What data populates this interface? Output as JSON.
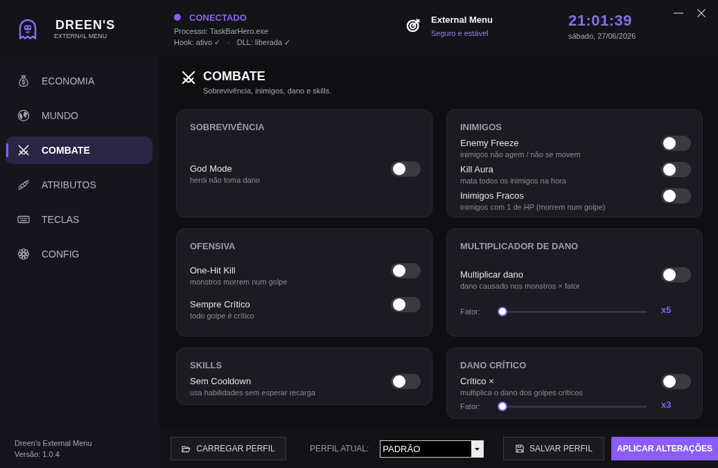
{
  "brand": {
    "title": "DREEN'S",
    "subtitle": "EXTERNAL MENU"
  },
  "status": {
    "connected": true,
    "label": "CONECTADO",
    "process": "Processo: TaskBarHero.exe",
    "details": [
      "Hook: ativo ✓",
      "·",
      "DLL: liberada ✓"
    ]
  },
  "service": {
    "title": "External Menu",
    "subtitle": "Seguro e estável"
  },
  "clock": {
    "time": "21:01:39",
    "date": "sábado, 27/06/2026"
  },
  "sidebar": {
    "items": [
      {
        "label": "ECONOMIA",
        "selected": false
      },
      {
        "label": "MUNDO",
        "selected": false
      },
      {
        "label": "COMBATE",
        "selected": true
      },
      {
        "label": "ATRIBUTOS",
        "selected": false
      },
      {
        "label": "TECLAS",
        "selected": false
      },
      {
        "label": "CONFIG",
        "selected": false
      }
    ],
    "footer": [
      "Dreen's External Menu",
      "Versão: 1.0.4"
    ]
  },
  "page": {
    "title": "COMBATE",
    "subtitle": "Sobrevivência, inimigos, dano e skills."
  },
  "cards": [
    {
      "title": "SOBREVIVÊNCIA",
      "items": [
        {
          "kind": "toggle",
          "label": "God Mode",
          "description": "herói não toma dano",
          "on": false
        }
      ]
    },
    {
      "title": "INIMIGOS",
      "items": [
        {
          "kind": "toggle",
          "label": "Enemy Freeze",
          "description": "inimigos não agem / não se movem",
          "on": false
        },
        {
          "kind": "toggle",
          "label": "Kill Aura",
          "description": "mata todos os inimigos na hora",
          "on": false
        },
        {
          "kind": "toggle",
          "label": "Inimigos Fracos",
          "description": "inimigos com 1 de HP (morrem num golpe)",
          "on": false
        }
      ]
    },
    {
      "title": "OFENSIVA",
      "items": [
        {
          "kind": "toggle",
          "label": "One-Hit Kill",
          "description": "monstros morrem num golpe",
          "on": false
        },
        {
          "kind": "toggle",
          "label": "Sempre Crítico",
          "description": "todo golpe é crítico",
          "on": false
        }
      ]
    },
    {
      "title": "MULTIPLICADOR DE DANO",
      "items": [
        {
          "kind": "toggle",
          "label": "Multiplicar dano",
          "description": "dano causado nos monstros × fator",
          "on": false
        },
        {
          "kind": "slider",
          "label": "Fator:",
          "level": 0,
          "reading": "x5"
        }
      ]
    },
    {
      "title": "SKILLS",
      "items": [
        {
          "kind": "toggle",
          "label": "Sem Cooldown",
          "description": "usa habilidades sem esperar recarga",
          "on": false
        }
      ]
    },
    {
      "title": "DANO CRÍTICO",
      "items": [
        {
          "kind": "toggle",
          "label": "Crítico ×",
          "description": "multiplica o dano dos golpes críticos",
          "on": false
        },
        {
          "kind": "slider",
          "label": "Fator:",
          "level": 0,
          "reading": "x3"
        }
      ]
    }
  ],
  "bottom_bar": {
    "load_button": "CARREGAR PERFIL",
    "profile_label": "PERFIL ATUAL:",
    "profile_value": "PADRÃO",
    "save_button": "SALVAR PERFIL",
    "apply_button": "APLICAR ALTERAÇÕES"
  }
}
